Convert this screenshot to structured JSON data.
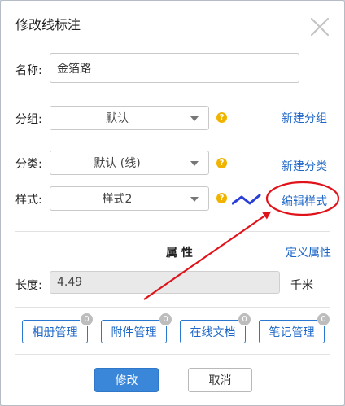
{
  "dialog": {
    "title": "修改线标注",
    "close_icon": "close-icon"
  },
  "form": {
    "name_label": "名称:",
    "name_value": "金箔路",
    "group_label": "分组:",
    "group_value": "默认",
    "category_label": "分类:",
    "category_value": "默认 (线)",
    "style_label": "样式:",
    "style_value": "样式2",
    "help_glyph": "?",
    "new_group_link": "新建分组",
    "new_category_link": "新建分类",
    "edit_style_link": "编辑样式",
    "line_style_preview_color": "#2a3fd8"
  },
  "attributes": {
    "heading": "属 性",
    "define_link": "定义属性",
    "length_label": "长度:",
    "length_value": "4.49",
    "length_unit": "千米"
  },
  "managers": [
    {
      "label": "相册管理",
      "count": "0"
    },
    {
      "label": "附件管理",
      "count": "0"
    },
    {
      "label": "在线文档",
      "count": "0"
    },
    {
      "label": "笔记管理",
      "count": "0"
    }
  ],
  "footer": {
    "confirm_label": "修改",
    "cancel_label": "取消"
  },
  "colors": {
    "accent": "#3a86d8",
    "link": "#1d67c8",
    "help": "#f0b400",
    "annotation": "#e0131a"
  }
}
